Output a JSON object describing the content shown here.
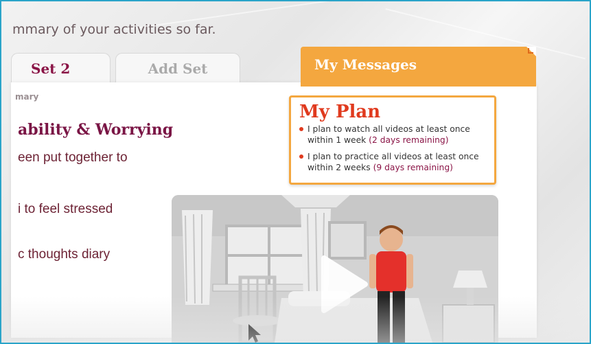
{
  "page": {
    "intro_text": "mmary of your activities so far."
  },
  "tabs": [
    {
      "label": "Set 2"
    },
    {
      "label": "Add Set"
    }
  ],
  "summary": {
    "section_label": "mary",
    "title": "ability & Worrying",
    "lines": [
      "een put together to",
      "i to feel stressed",
      "c thoughts diary"
    ]
  },
  "messages": {
    "tab_label": "My Messages"
  },
  "plan": {
    "title": "My Plan",
    "items": [
      {
        "text": "I plan to watch all videos  at least once within 1 week",
        "remaining": "(2 days remaining)"
      },
      {
        "text": "I plan to practice all videos at least once within 2 weeks",
        "remaining": "(9 days remaining)"
      }
    ]
  },
  "video": {
    "play_icon": "play-icon"
  },
  "colors": {
    "frame_border": "#2aa4c9",
    "brand_maroon": "#8a1446",
    "accent_orange": "#f4a73f",
    "plan_red": "#e03a1e"
  }
}
